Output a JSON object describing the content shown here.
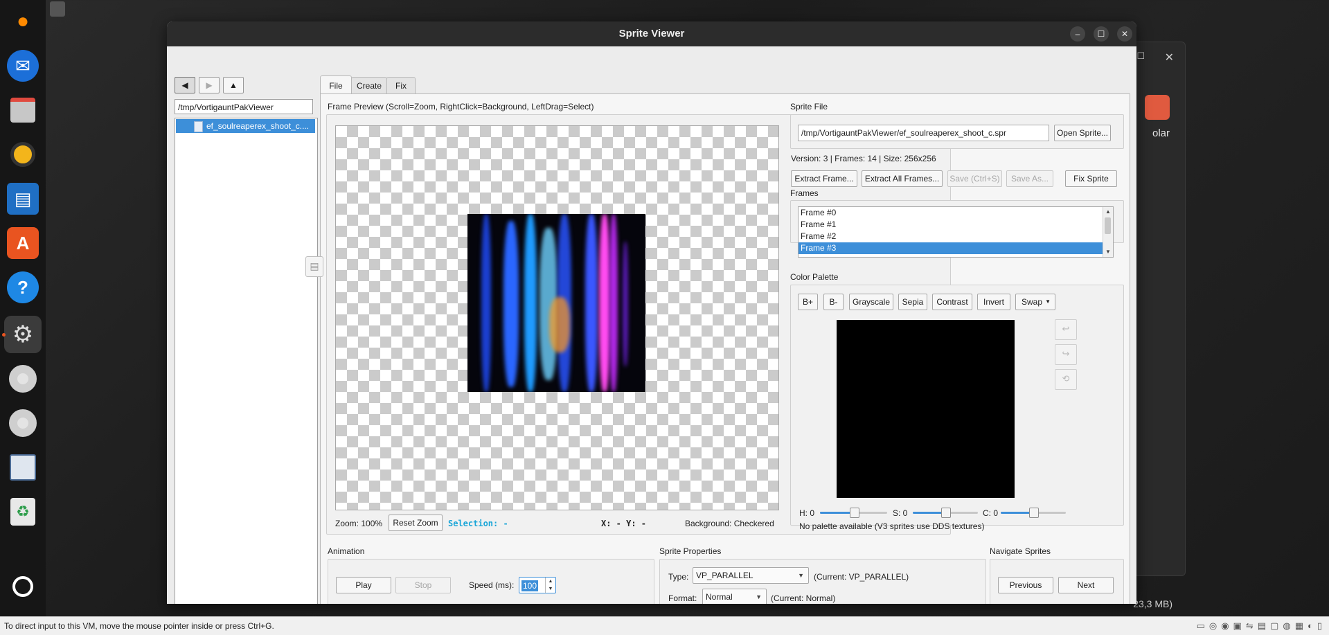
{
  "desktop": {
    "bg_window_text": "olar",
    "bg_window_size": "23,3 MB)"
  },
  "dock": {
    "items": [
      {
        "name": "firefox-icon",
        "glyph": "🦊"
      },
      {
        "name": "thunderbird-icon",
        "glyph": "✉"
      },
      {
        "name": "files-icon",
        "glyph": "▬"
      },
      {
        "name": "rhythmbox-icon",
        "glyph": "◉"
      },
      {
        "name": "writer-icon",
        "glyph": "▤"
      },
      {
        "name": "app-center-icon",
        "glyph": "A"
      },
      {
        "name": "help-icon",
        "glyph": "?"
      },
      {
        "name": "settings-icon",
        "glyph": "⚙"
      },
      {
        "name": "disc-icon",
        "glyph": "◎"
      },
      {
        "name": "disc-icon-2",
        "glyph": "◎"
      },
      {
        "name": "save-disk-icon",
        "glyph": "▤"
      },
      {
        "name": "trash-icon",
        "glyph": "♻"
      },
      {
        "name": "show-apps-icon",
        "glyph": "⦿"
      }
    ]
  },
  "window": {
    "title": "Sprite Viewer"
  },
  "browser": {
    "path": "/tmp/VortigauntPakViewer",
    "files": [
      "ef_soulreaperex_shoot_c...."
    ]
  },
  "tabs": [
    "File",
    "Create",
    "Fix"
  ],
  "preview": {
    "header": "Frame Preview (Scroll=Zoom, RightClick=Background, LeftDrag=Select)",
    "zoom": "Zoom: 100%",
    "reset_zoom": "Reset Zoom",
    "selection": "Selection: -",
    "coords": "X: - Y: -",
    "background": "Background: Checkered"
  },
  "sprite_file": {
    "header": "Sprite File",
    "path": "/tmp/VortigauntPakViewer/ef_soulreaperex_shoot_c.spr",
    "open_button": "Open Sprite...",
    "info": "Version: 3 | Frames: 14 | Size: 256x256",
    "buttons": {
      "extract_frame": "Extract Frame...",
      "extract_all": "Extract All Frames...",
      "save": "Save (Ctrl+S)",
      "save_as": "Save As...",
      "fix": "Fix Sprite"
    }
  },
  "frames": {
    "header": "Frames",
    "items": [
      "Frame #0",
      "Frame #1",
      "Frame #2",
      "Frame #3"
    ],
    "selected": "Frame #3"
  },
  "palette": {
    "header": "Color Palette",
    "buttons": [
      "B+",
      "B-",
      "Grayscale",
      "Sepia",
      "Contrast",
      "Invert",
      "Swap"
    ],
    "h_label": "H: 0",
    "s_label": "S: 0",
    "c_label": "C: 0",
    "h_value": 0.5,
    "s_value": 0.5,
    "c_value": 0.5,
    "note": "No palette available (V3 sprites use DDS textures)"
  },
  "animation": {
    "header": "Animation",
    "play": "Play",
    "stop": "Stop",
    "speed_label": "Speed (ms):",
    "speed_value": "100"
  },
  "properties": {
    "header": "Sprite Properties",
    "type_label": "Type:",
    "type_value": "VP_PARALLEL",
    "type_current": "(Current: VP_PARALLEL)",
    "format_label": "Format:",
    "format_value": "Normal",
    "format_current": "(Current: Normal)"
  },
  "navigate": {
    "header": "Navigate Sprites",
    "previous": "Previous",
    "next": "Next"
  },
  "statusbar": {
    "message": "To direct input to this VM, move the mouse pointer inside or press Ctrl+G."
  },
  "colors": {
    "accent": "#3d8fd9",
    "selection_text": "#1aa6d8"
  }
}
